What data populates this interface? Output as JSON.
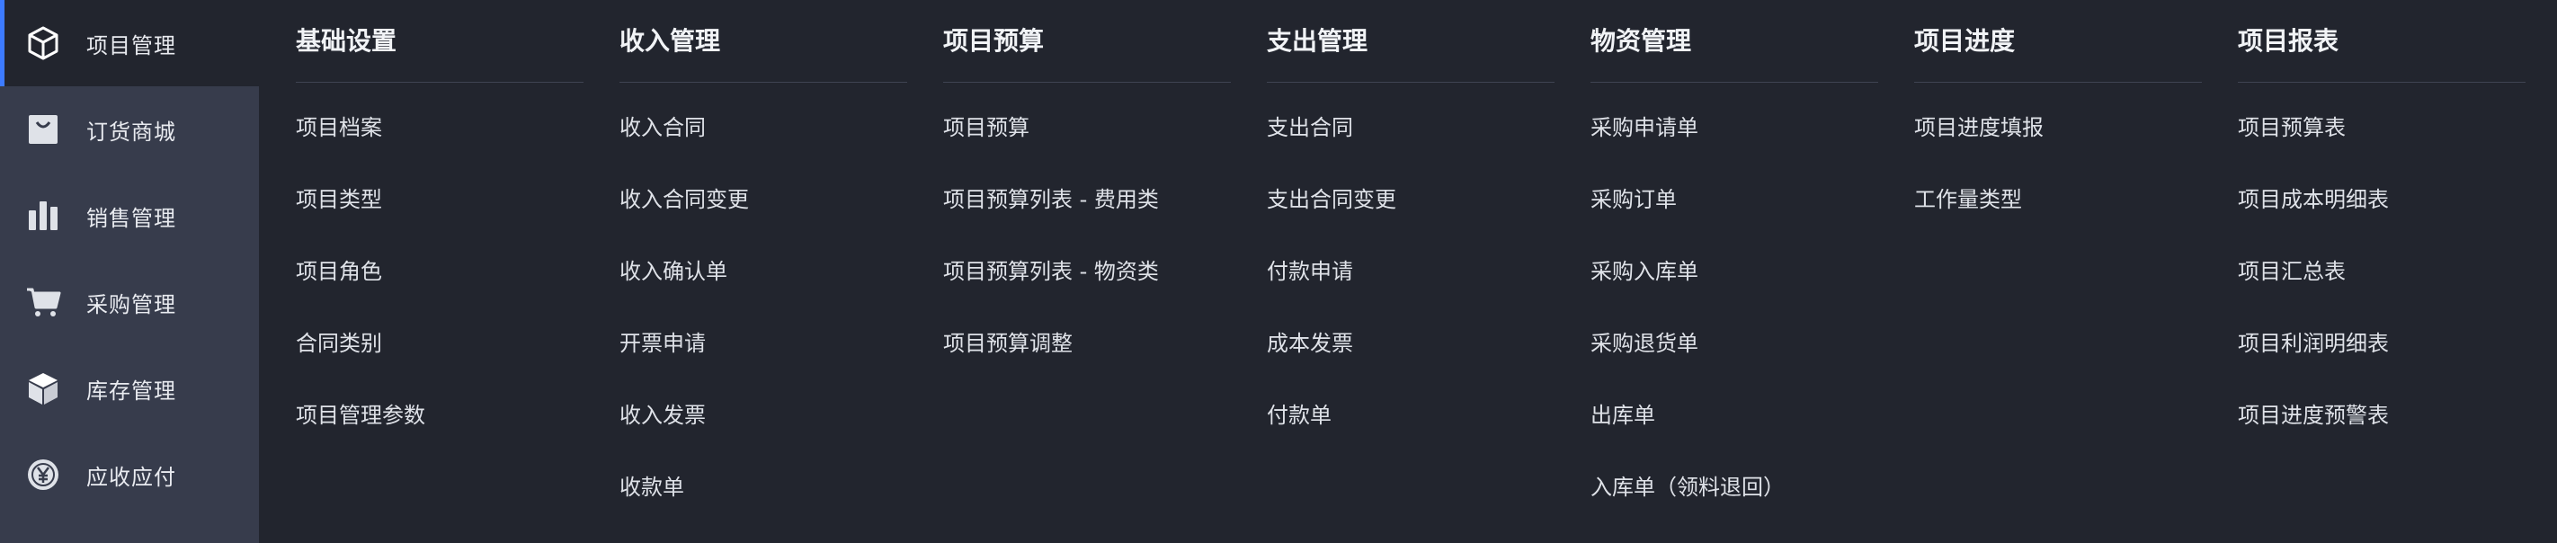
{
  "sidebar": {
    "items": [
      {
        "label": "项目管理",
        "icon": "box-icon",
        "active": true
      },
      {
        "label": "订货商城",
        "icon": "shopping-bag-icon"
      },
      {
        "label": "销售管理",
        "icon": "bar-chart-icon"
      },
      {
        "label": "采购管理",
        "icon": "shopping-cart-icon"
      },
      {
        "label": "库存管理",
        "icon": "cube-icon"
      },
      {
        "label": "应收应付",
        "icon": "yen-coin-icon"
      }
    ]
  },
  "menu": {
    "columns": [
      {
        "title": "基础设置",
        "items": [
          "项目档案",
          "项目类型",
          "项目角色",
          "合同类别",
          "项目管理参数"
        ]
      },
      {
        "title": "收入管理",
        "items": [
          "收入合同",
          "收入合同变更",
          "收入确认单",
          "开票申请",
          "收入发票",
          "收款单"
        ]
      },
      {
        "title": "项目预算",
        "items": [
          "项目预算",
          "项目预算列表 - 费用类",
          "项目预算列表 - 物资类",
          "项目预算调整"
        ]
      },
      {
        "title": "支出管理",
        "items": [
          "支出合同",
          "支出合同变更",
          "付款申请",
          "成本发票",
          "付款单"
        ]
      },
      {
        "title": "物资管理",
        "items": [
          "采购申请单",
          "采购订单",
          "采购入库单",
          "采购退货单",
          "出库单",
          "入库单（领料退回）"
        ]
      },
      {
        "title": "项目进度",
        "items": [
          "项目进度填报",
          "工作量类型"
        ]
      },
      {
        "title": "项目报表",
        "items": [
          "项目预算表",
          "项目成本明细表",
          "项目汇总表",
          "项目利润明细表",
          "项目进度预警表"
        ]
      }
    ]
  },
  "colors": {
    "accent": "#3d7bff",
    "sidebar_bg": "#373c4c",
    "panel_bg": "#22252e"
  }
}
